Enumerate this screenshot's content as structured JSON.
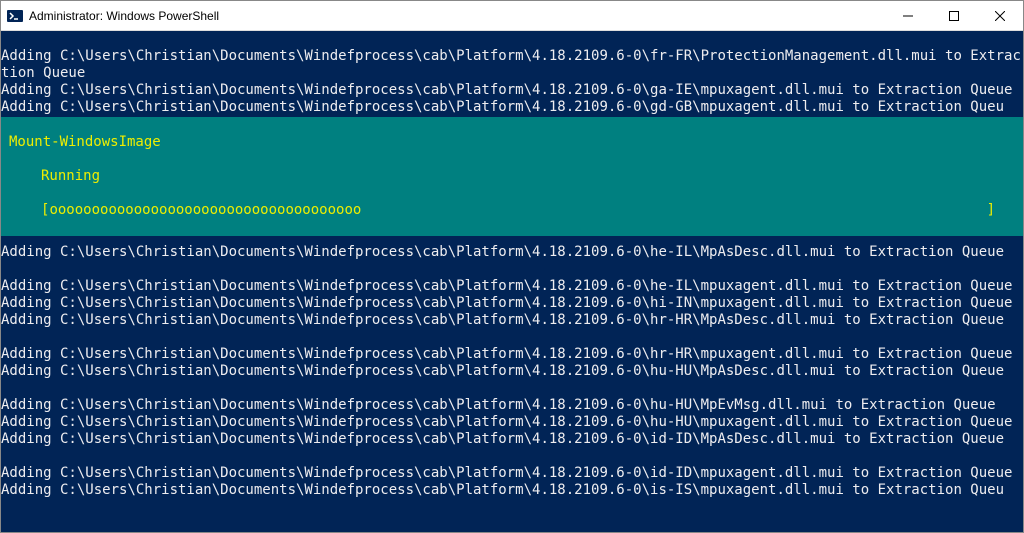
{
  "window": {
    "title": "Administrator: Windows PowerShell"
  },
  "progress": {
    "title": "Mount-WindowsImage",
    "status": "Running",
    "bar_open": "[",
    "bar_fill": "ooooooooooooooooooooooooooooooooooooo",
    "bar_close": "]"
  },
  "lines_before": [
    "Adding C:\\Users\\Christian\\Documents\\Windefprocess\\cab\\Platform\\4.18.2109.6-0\\fr-FR\\ProtectionManagement.dll.mui to Extraction Queue",
    "Adding C:\\Users\\Christian\\Documents\\Windefprocess\\cab\\Platform\\4.18.2109.6-0\\ga-IE\\mpuxagent.dll.mui to Extraction Queue",
    "Adding C:\\Users\\Christian\\Documents\\Windefprocess\\cab\\Platform\\4.18.2109.6-0\\gd-GB\\mpuxagent.dll.mui to Extraction Queu"
  ],
  "lines_after": [
    "Adding C:\\Users\\Christian\\Documents\\Windefprocess\\cab\\Platform\\4.18.2109.6-0\\he-IL\\MpAsDesc.dll.mui to Extraction Queue",
    "",
    "Adding C:\\Users\\Christian\\Documents\\Windefprocess\\cab\\Platform\\4.18.2109.6-0\\he-IL\\mpuxagent.dll.mui to Extraction Queue",
    "Adding C:\\Users\\Christian\\Documents\\Windefprocess\\cab\\Platform\\4.18.2109.6-0\\hi-IN\\mpuxagent.dll.mui to Extraction Queue",
    "Adding C:\\Users\\Christian\\Documents\\Windefprocess\\cab\\Platform\\4.18.2109.6-0\\hr-HR\\MpAsDesc.dll.mui to Extraction Queue",
    "",
    "Adding C:\\Users\\Christian\\Documents\\Windefprocess\\cab\\Platform\\4.18.2109.6-0\\hr-HR\\mpuxagent.dll.mui to Extraction Queue",
    "Adding C:\\Users\\Christian\\Documents\\Windefprocess\\cab\\Platform\\4.18.2109.6-0\\hu-HU\\MpAsDesc.dll.mui to Extraction Queue",
    "",
    "Adding C:\\Users\\Christian\\Documents\\Windefprocess\\cab\\Platform\\4.18.2109.6-0\\hu-HU\\MpEvMsg.dll.mui to Extraction Queue",
    "Adding C:\\Users\\Christian\\Documents\\Windefprocess\\cab\\Platform\\4.18.2109.6-0\\hu-HU\\mpuxagent.dll.mui to Extraction Queue",
    "Adding C:\\Users\\Christian\\Documents\\Windefprocess\\cab\\Platform\\4.18.2109.6-0\\id-ID\\MpAsDesc.dll.mui to Extraction Queue",
    "",
    "Adding C:\\Users\\Christian\\Documents\\Windefprocess\\cab\\Platform\\4.18.2109.6-0\\id-ID\\mpuxagent.dll.mui to Extraction Queue",
    "Adding C:\\Users\\Christian\\Documents\\Windefprocess\\cab\\Platform\\4.18.2109.6-0\\is-IS\\mpuxagent.dll.mui to Extraction Queu"
  ]
}
